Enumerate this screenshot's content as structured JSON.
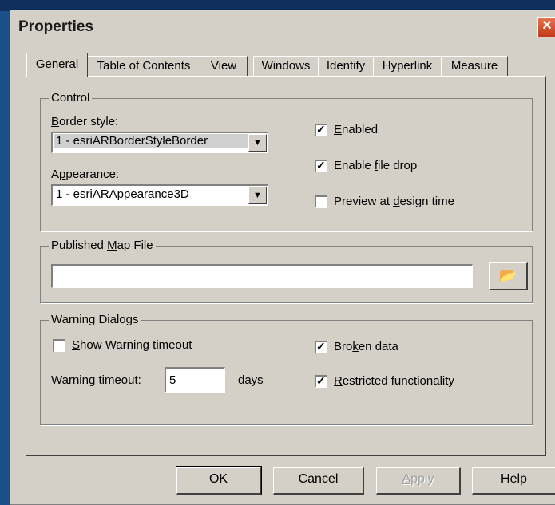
{
  "window": {
    "title": "Properties",
    "close_glyph": "✕"
  },
  "tabs": [
    "General",
    "Table of Contents",
    "View",
    "Windows",
    "Identify",
    "Hyperlink",
    "Measure"
  ],
  "control": {
    "legend": "Control",
    "border_style_label_pre": "",
    "border_style_label_u": "B",
    "border_style_label_post": "order style:",
    "border_style_value": "1 - esriARBorderStyleBorder",
    "appearance_label_pre": "A",
    "appearance_label_u": "p",
    "appearance_label_post": "pearance:",
    "appearance_value": "1 - esriARAppearance3D",
    "enabled": {
      "pre": "",
      "u": "E",
      "post": "nabled",
      "checked": true
    },
    "enable_file_drop": {
      "pre": "Enable ",
      "u": "f",
      "post": "ile drop",
      "checked": true
    },
    "preview_design": {
      "pre": "Preview at ",
      "u": "d",
      "post": "esign time",
      "checked": false
    }
  },
  "published": {
    "legend_pre": "Published ",
    "legend_u": "M",
    "legend_post": "ap File",
    "value": "",
    "browse_icon": "open-folder-icon"
  },
  "warning": {
    "legend": "Warning Dialogs",
    "show_timeout": {
      "pre": "",
      "u": "S",
      "post": "how Warning timeout",
      "checked": false
    },
    "timeout_label_pre": "",
    "timeout_label_u": "W",
    "timeout_label_post": "arning timeout:",
    "timeout_value": "5",
    "days_label": "days",
    "broken_data": {
      "pre": "Bro",
      "u": "k",
      "post": "en data",
      "checked": true
    },
    "restricted": {
      "pre": "",
      "u": "R",
      "post": "estricted functionality",
      "checked": true
    }
  },
  "buttons": {
    "ok": "OK",
    "cancel": "Cancel",
    "apply_pre": "",
    "apply_u": "A",
    "apply_post": "pply",
    "help": "Help"
  },
  "check_glyph": "✓"
}
